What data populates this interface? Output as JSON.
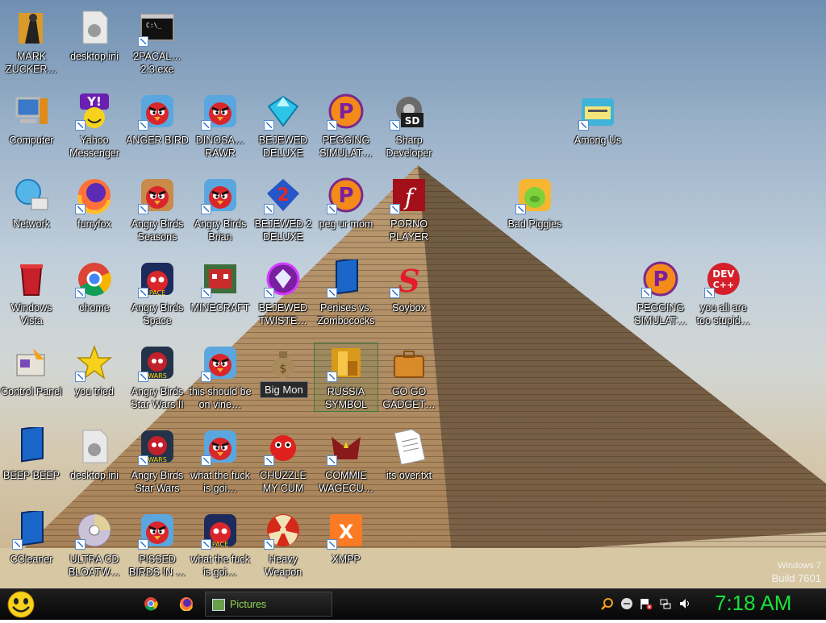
{
  "desktop": {
    "icons": [
      {
        "label": "MARK ZUCKER…",
        "icon": "person-figure-icon",
        "shortcut": false
      },
      {
        "label": "desktop.ini",
        "icon": "config-file-icon",
        "shortcut": false
      },
      {
        "label": "2PACAL… 2.3.exe",
        "icon": "console-exe-icon",
        "shortcut": true
      },
      {
        "label": "Computer",
        "icon": "computer-icon",
        "shortcut": false
      },
      {
        "label": "Yahoo Messenger",
        "icon": "yahoo-smiley-icon",
        "shortcut": true
      },
      {
        "label": "ANGER BIRD",
        "icon": "angry-bird-icon",
        "shortcut": true
      },
      {
        "label": "DINOSA… RAWR",
        "icon": "angry-bird-icon",
        "shortcut": true
      },
      {
        "label": "BEJEWED DELUXE",
        "icon": "gem-icon",
        "shortcut": true
      },
      {
        "label": "PEGGING SIMULAT…",
        "icon": "pegging-p-icon",
        "shortcut": true
      },
      {
        "label": "Sharp Developer",
        "icon": "sharp-developer-icon",
        "shortcut": true
      },
      {
        "label": "Among Us",
        "icon": "among-us-folder-icon",
        "shortcut": true
      },
      {
        "label": "Network",
        "icon": "network-globe-icon",
        "shortcut": false
      },
      {
        "label": "furryfox",
        "icon": "firefox-icon",
        "shortcut": true
      },
      {
        "label": "Angry Birds Seasons",
        "icon": "angry-birds-seasons-icon",
        "shortcut": true
      },
      {
        "label": "Angry Birds Brian",
        "icon": "angry-birds-brian-icon",
        "shortcut": true
      },
      {
        "label": "BEJEWED 2 DELUXE",
        "icon": "bejeweled-2-icon",
        "shortcut": true
      },
      {
        "label": "peg ur mom",
        "icon": "pegging-p-icon",
        "shortcut": true
      },
      {
        "label": "PORNO PLAYER",
        "icon": "flash-icon",
        "shortcut": true
      },
      {
        "label": "Bad Piggies",
        "icon": "bad-piggies-icon",
        "shortcut": true
      },
      {
        "label": "Windows Vista",
        "icon": "recycle-bin-icon",
        "shortcut": false
      },
      {
        "label": "chome",
        "icon": "chrome-icon",
        "shortcut": true
      },
      {
        "label": "Angry Birds Space",
        "icon": "angry-birds-space-icon",
        "shortcut": true
      },
      {
        "label": "MINECRAFT",
        "icon": "minecraft-bird-icon",
        "shortcut": true
      },
      {
        "label": "BEJEWED TWISTE…",
        "icon": "bejeweled-twist-icon",
        "shortcut": true
      },
      {
        "label": "Penises vs. Zombococks",
        "icon": "blue-panel-icon",
        "shortcut": true
      },
      {
        "label": "Soybox",
        "icon": "shockwave-icon",
        "shortcut": true
      },
      {
        "label": "PEGGING SIMULAT…",
        "icon": "pegging-p-icon",
        "shortcut": true
      },
      {
        "label": "you all are too stupid…",
        "icon": "dev-cpp-icon",
        "shortcut": true
      },
      {
        "label": "Control Panel",
        "icon": "control-panel-icon",
        "shortcut": false
      },
      {
        "label": "you tried",
        "icon": "star-icon",
        "shortcut": true
      },
      {
        "label": "Angry Birds Star Wars II",
        "icon": "angry-birds-star-wars-icon",
        "shortcut": true
      },
      {
        "label": "this should be on vine…",
        "icon": "angry-bird-icon",
        "shortcut": true
      },
      {
        "label": "",
        "icon": "money-bag-icon",
        "shortcut": false
      },
      {
        "label": "RUSSIA SYMBOL",
        "icon": "russia-symbol-icon",
        "shortcut": true
      },
      {
        "label": "GO GO GADGET…",
        "icon": "briefcase-icon",
        "shortcut": false
      },
      {
        "label": "BEEP BEEP",
        "icon": "blue-panel-icon",
        "shortcut": false
      },
      {
        "label": "desktop.ini",
        "icon": "config-file-icon",
        "shortcut": false
      },
      {
        "label": "Angry Birds Star Wars",
        "icon": "angry-birds-star-wars-icon",
        "shortcut": true
      },
      {
        "label": "what the fuck is goi…",
        "icon": "angry-bird-icon",
        "shortcut": true
      },
      {
        "label": "CHUZZLE MY CUM",
        "icon": "chuzzle-icon",
        "shortcut": true
      },
      {
        "label": "COMMIE WAGECU…",
        "icon": "commie-icon",
        "shortcut": true
      },
      {
        "label": "its over.txt",
        "icon": "text-file-icon",
        "shortcut": false
      },
      {
        "label": "CCleaner",
        "icon": "blue-panel-icon",
        "shortcut": true
      },
      {
        "label": "ULTRA CD BLOATW…",
        "icon": "cd-icon",
        "shortcut": true
      },
      {
        "label": "PISSED BIRDS IN …",
        "icon": "angry-bird-icon",
        "shortcut": true
      },
      {
        "label": "what the fuck is goi…",
        "icon": "angry-birds-space-icon",
        "shortcut": true
      },
      {
        "label": "Heavy Weapon",
        "icon": "radiation-icon",
        "shortcut": true
      },
      {
        "label": "XMPP",
        "icon": "xampp-icon",
        "shortcut": true
      }
    ],
    "tooltip": "Big Mon",
    "watermark": {
      "line1": "Windows 7",
      "line2": "Build 7601"
    }
  },
  "taskbar": {
    "start_icon": "smiley-start-icon",
    "pinned": [
      {
        "icon": "chrome-icon"
      },
      {
        "icon": "firefox-icon"
      }
    ],
    "window_button": "Pictures",
    "tray": [
      {
        "icon": "search-icon"
      },
      {
        "icon": "messenger-icon"
      },
      {
        "icon": "flag-icon"
      },
      {
        "icon": "network-icon"
      },
      {
        "icon": "volume-icon"
      }
    ],
    "clock": "7:18 AM"
  },
  "colors": {
    "clock": "#17e237",
    "window_button_text": "#8fd94f"
  }
}
